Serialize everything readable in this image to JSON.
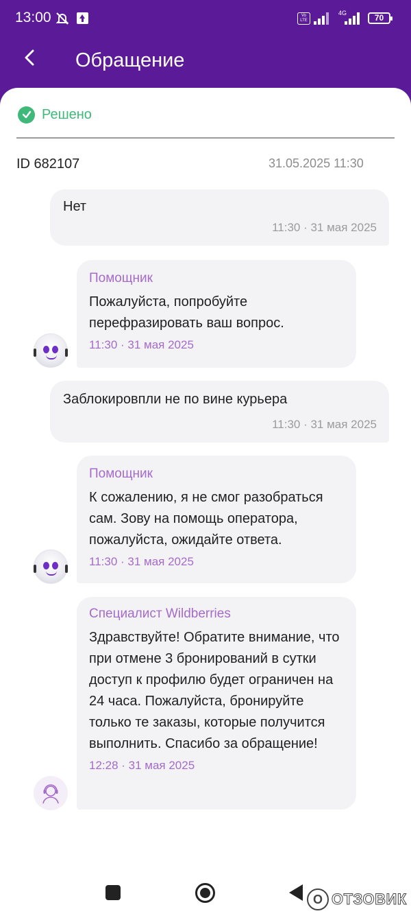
{
  "status_bar": {
    "time": "13:00",
    "battery": "70",
    "network": "4G",
    "volte": "Vo LTE"
  },
  "header": {
    "title": "Обращение"
  },
  "ticket": {
    "status": "Решено",
    "id_label": "ID 682107",
    "created": "31.05.2025 11:30"
  },
  "messages": [
    {
      "side": "user",
      "text": "Нет",
      "time": "11:30 · 31 мая 2025"
    },
    {
      "side": "bot",
      "sender": "Помощник",
      "text": "Пожалуйста, попробуйте перефразировать ваш вопрос.",
      "time": "11:30 · 31 мая 2025"
    },
    {
      "side": "user",
      "text": "Заблокировпли не по вине курьера",
      "time": "11:30 · 31 мая 2025"
    },
    {
      "side": "bot",
      "sender": "Помощник",
      "text": "К сожалению, я не смог разобраться сам. Зову на помощь оператора, пожалуйста, ожидайте ответа.",
      "time": "11:30 · 31 мая 2025"
    },
    {
      "side": "bot",
      "sender": "Специалист Wildberries",
      "text": "Здравствуйте! Обратите внимание, что при отмене 3 бронирований в сутки доступ к профилю будет ограничен на 24 часа. Пожалуйста, бронируйте только те заказы, которые получится выполнить. Спасибо за обращение!",
      "time": "12:28 · 31 мая 2025"
    }
  ],
  "watermark": {
    "text": "ОТЗОВИК",
    "letter": "О"
  },
  "colors": {
    "header_bg": "#5b1a97",
    "accent": "#a56bc9",
    "success": "#3fb97a",
    "bubble_bg": "#f3f3f6"
  },
  "icons": {
    "back": "chevron-left-icon",
    "status": "check-circle-icon",
    "bot_avatar": "robot-avatar",
    "specialist_avatar": "operator-headset-avatar"
  }
}
